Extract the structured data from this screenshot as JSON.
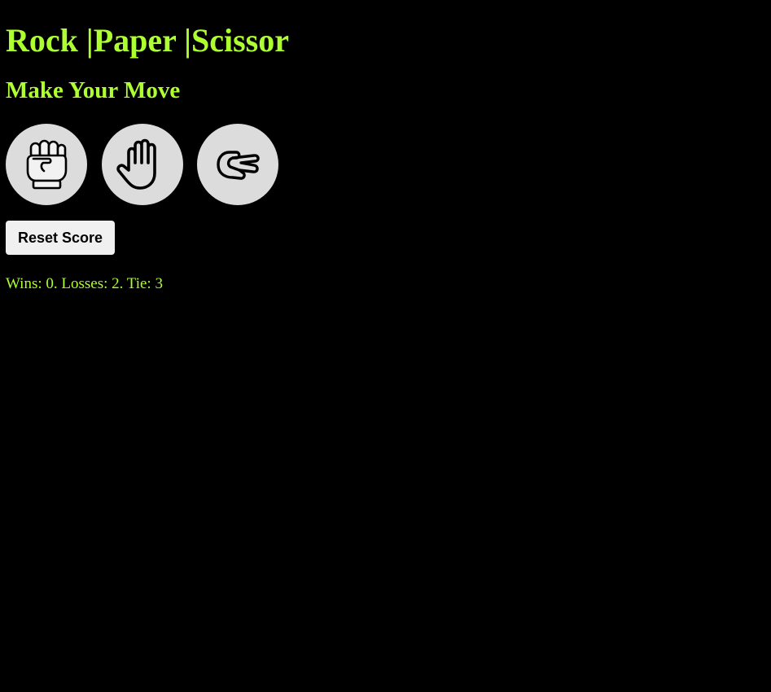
{
  "title": "Rock |Paper |Scissor",
  "subtitle": "Make Your Move",
  "moves": [
    {
      "name": "rock",
      "icon": "fist-icon"
    },
    {
      "name": "paper",
      "icon": "open-hand-icon"
    },
    {
      "name": "scissors",
      "icon": "scissors-hand-icon"
    }
  ],
  "reset_label": "Reset Score",
  "score_text": "Wins: 0. Losses: 2. Tie: 3",
  "colors": {
    "background": "#000000",
    "accent": "#adff2f",
    "move_button_bg": "#dcdcdc",
    "reset_button_bg": "#f0f0f0"
  }
}
